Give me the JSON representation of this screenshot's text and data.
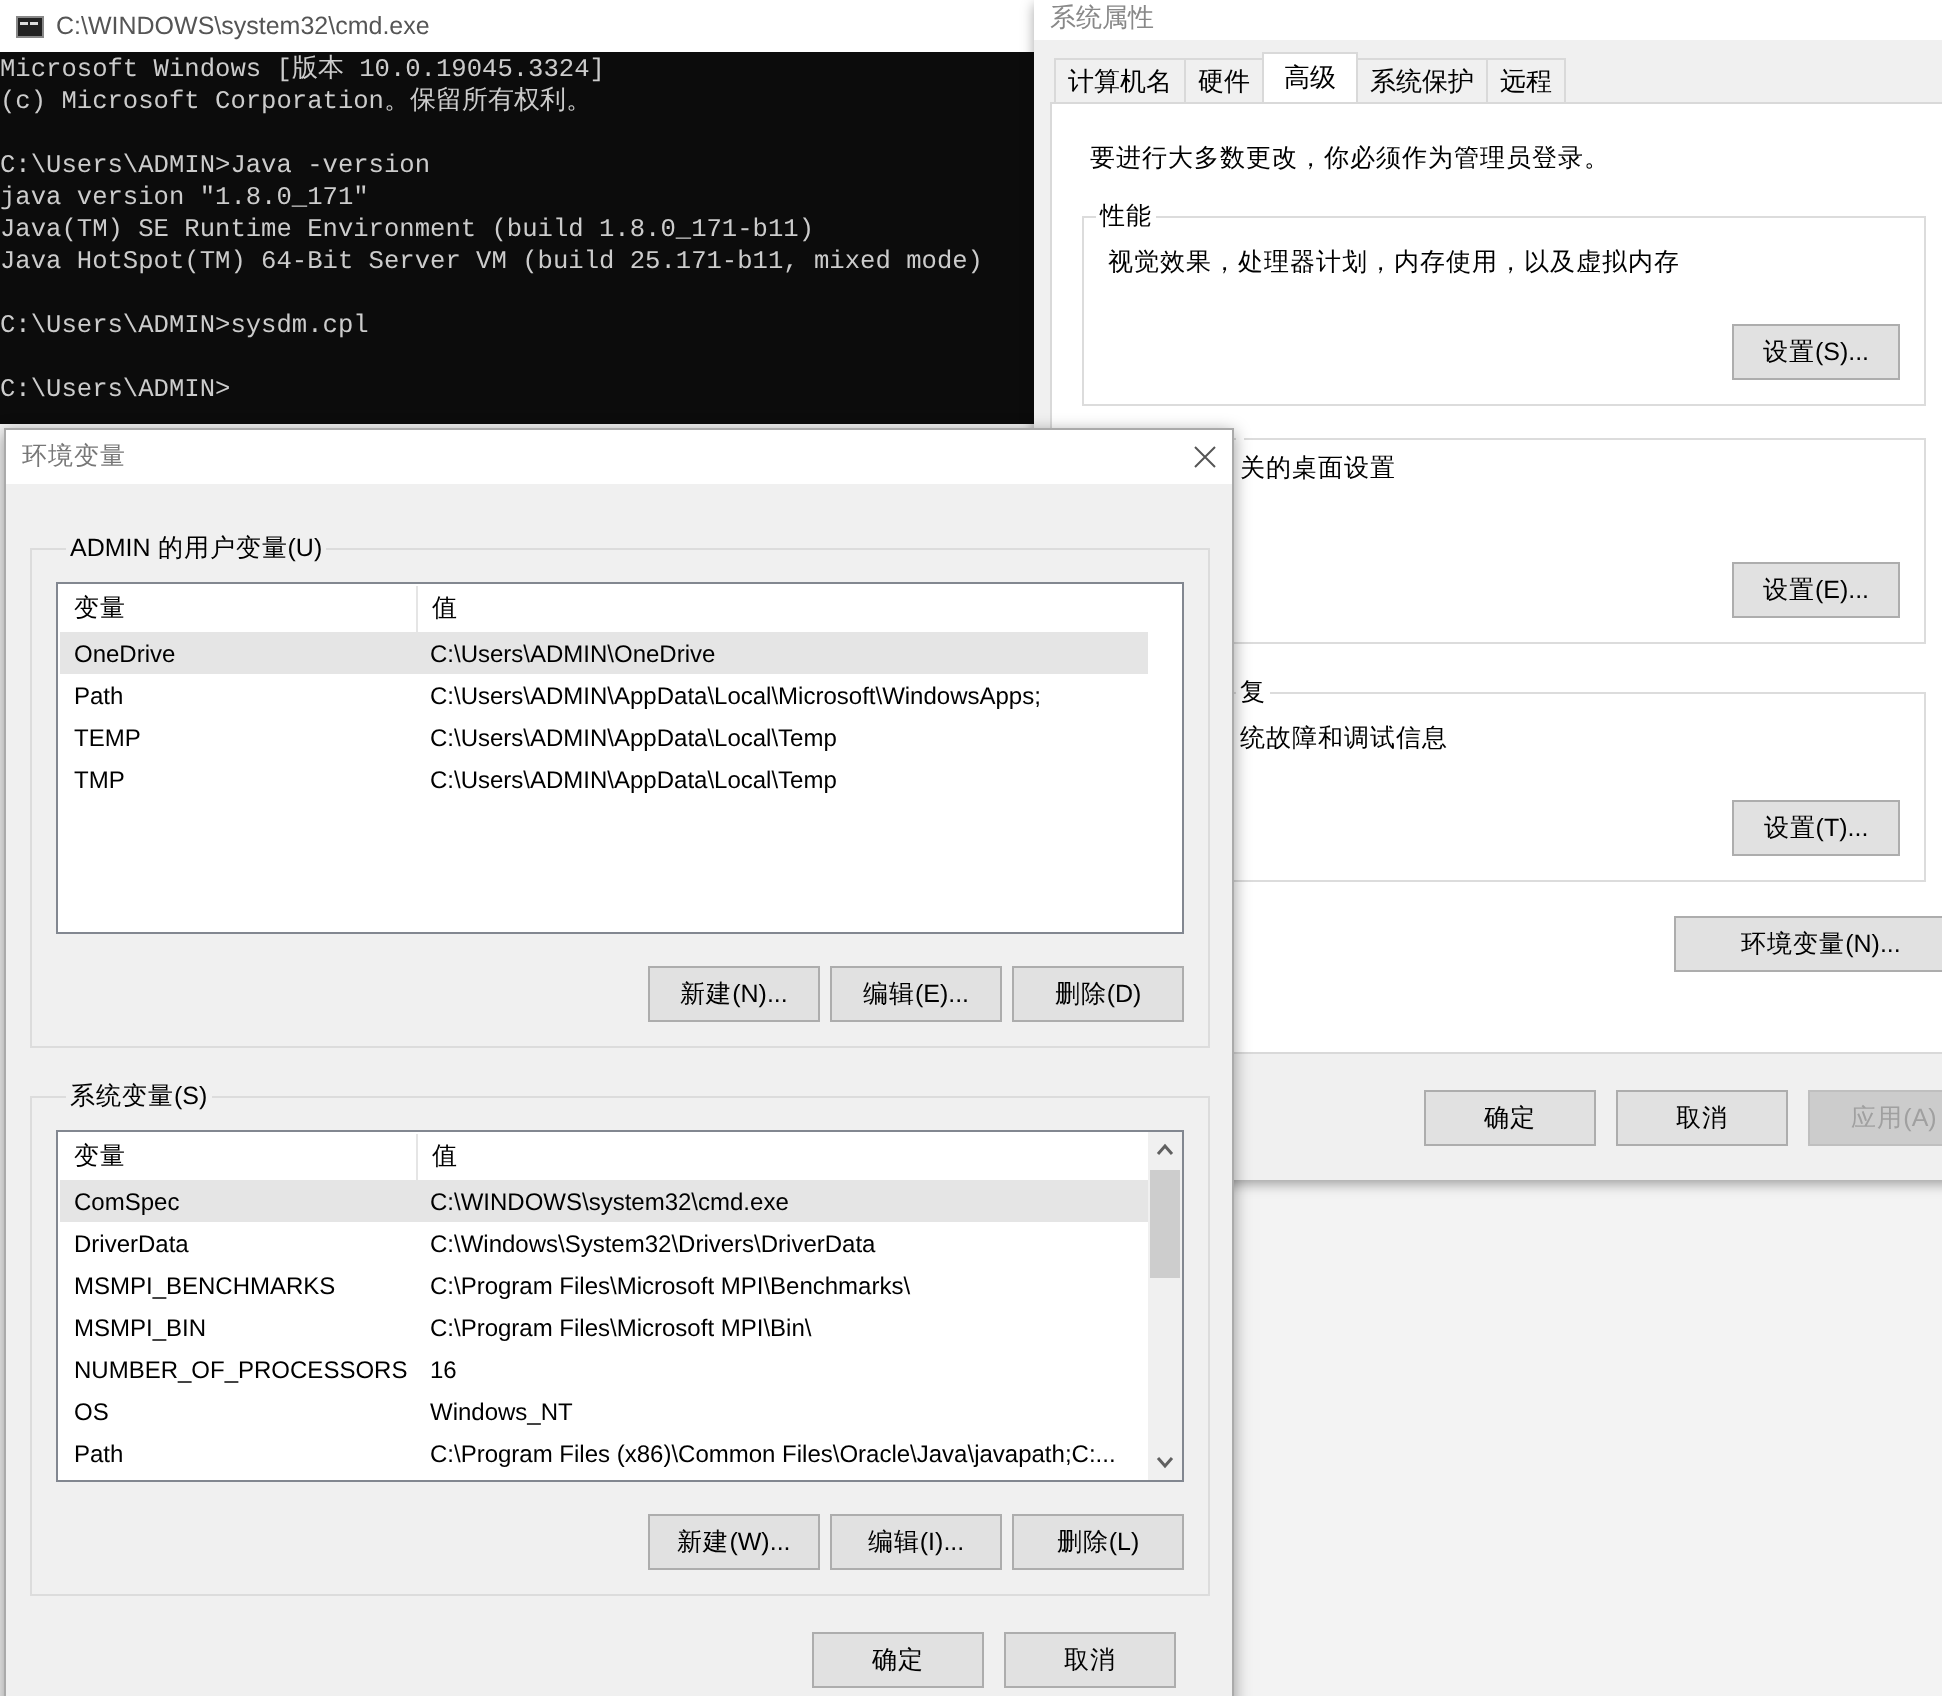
{
  "cmd_window": {
    "title": "C:\\WINDOWS\\system32\\cmd.exe",
    "blocks": [
      [
        "Microsoft Windows [版本 10.0.19045.3324]",
        "(c) Microsoft Corporation。保留所有权利。"
      ],
      [
        "C:\\Users\\ADMIN>Java -version",
        "java version \"1.8.0_171\"",
        "Java(TM) SE Runtime Environment (build 1.8.0_171-b11)",
        "Java HotSpot(TM) 64-Bit Server VM (build 25.171-b11, mixed mode)"
      ],
      [
        "C:\\Users\\ADMIN>sysdm.cpl"
      ],
      [
        "C:\\Users\\ADMIN>"
      ]
    ]
  },
  "system_properties": {
    "title": "系统属性",
    "tabs": [
      {
        "label": "计算机名",
        "selected": false
      },
      {
        "label": "硬件",
        "selected": false
      },
      {
        "label": "高级",
        "selected": true
      },
      {
        "label": "系统保护",
        "selected": false
      },
      {
        "label": "远程",
        "selected": false
      }
    ],
    "notice": "要进行大多数更改，你必须作为管理员登录。",
    "groups": [
      {
        "title": "性能",
        "text": "视觉效果，处理器计划，内存使用，以及虚拟内存",
        "button": "设置(S)..."
      },
      {
        "text": "关的桌面设置",
        "button": "设置(E)..."
      },
      {
        "title": "复",
        "text": "统故障和调试信息",
        "button": "设置(T)..."
      }
    ],
    "env_button": "环境变量(N)...",
    "buttons": [
      {
        "label": "确定",
        "disabled": false
      },
      {
        "label": "取消",
        "disabled": false
      },
      {
        "label": "应用(A)",
        "disabled": true
      }
    ]
  },
  "environment_variables": {
    "title": "环境变量",
    "sections": [
      {
        "title": "ADMIN 的用户变量(U)",
        "columns": [
          "变量",
          "值"
        ],
        "scrollbar": false,
        "rows": [
          {
            "name": "OneDrive",
            "value": "C:\\Users\\ADMIN\\OneDrive",
            "selected": true
          },
          {
            "name": "Path",
            "value": "C:\\Users\\ADMIN\\AppData\\Local\\Microsoft\\WindowsApps;",
            "selected": false
          },
          {
            "name": "TEMP",
            "value": "C:\\Users\\ADMIN\\AppData\\Local\\Temp",
            "selected": false
          },
          {
            "name": "TMP",
            "value": "C:\\Users\\ADMIN\\AppData\\Local\\Temp",
            "selected": false
          }
        ],
        "buttons": [
          "新建(N)...",
          "编辑(E)...",
          "删除(D)"
        ]
      },
      {
        "title": "系统变量(S)",
        "columns": [
          "变量",
          "值"
        ],
        "scrollbar": true,
        "rows": [
          {
            "name": "ComSpec",
            "value": "C:\\WINDOWS\\system32\\cmd.exe",
            "selected": true
          },
          {
            "name": "DriverData",
            "value": "C:\\Windows\\System32\\Drivers\\DriverData",
            "selected": false
          },
          {
            "name": "MSMPI_BENCHMARKS",
            "value": "C:\\Program Files\\Microsoft MPI\\Benchmarks\\",
            "selected": false
          },
          {
            "name": "MSMPI_BIN",
            "value": "C:\\Program Files\\Microsoft MPI\\Bin\\",
            "selected": false
          },
          {
            "name": "NUMBER_OF_PROCESSORS",
            "value": "16",
            "selected": false
          },
          {
            "name": "OS",
            "value": "Windows_NT",
            "selected": false
          },
          {
            "name": "Path",
            "value": "C:\\Program Files (x86)\\Common Files\\Oracle\\Java\\javapath;C:...",
            "selected": false
          }
        ],
        "buttons": [
          "新建(W)...",
          "编辑(I)...",
          "删除(L)"
        ]
      }
    ],
    "buttons": [
      "确定",
      "取消"
    ]
  }
}
